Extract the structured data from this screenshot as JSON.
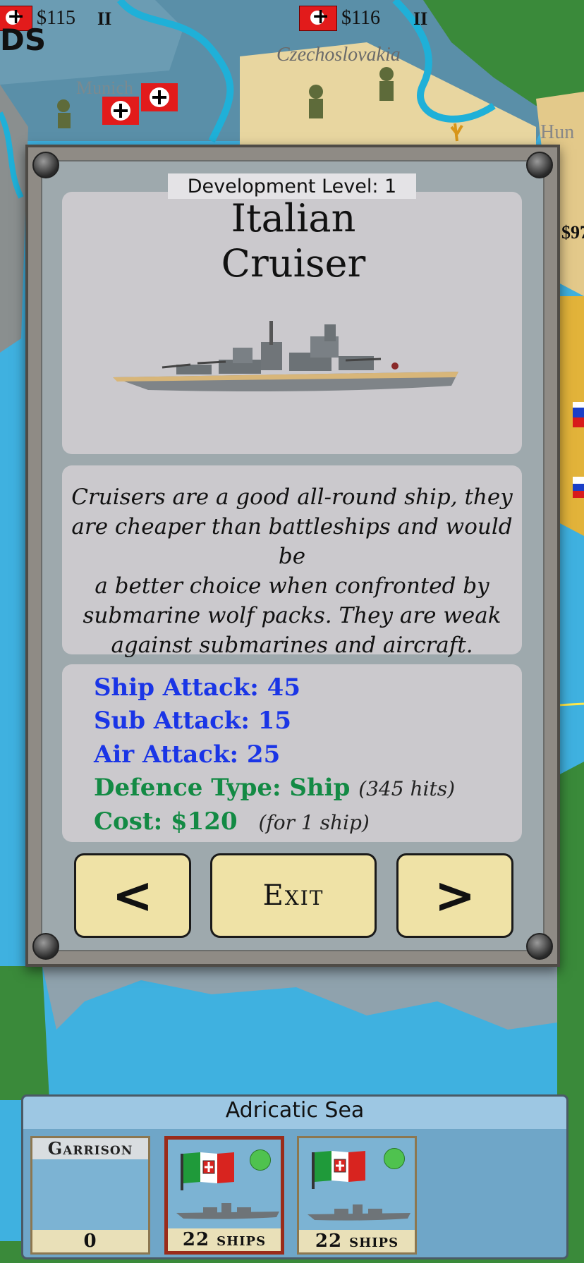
{
  "map": {
    "prices": [
      {
        "label": "$115",
        "roman": "II"
      },
      {
        "label": "$116",
        "roman": "II"
      },
      {
        "label": "$97"
      }
    ],
    "region_labels": [
      "DS",
      "Czechoslovakia",
      "Munich",
      "Hun"
    ],
    "colors": {
      "sea": "#3fb1e0",
      "land_green": "#3a8a3a",
      "land_tan": "#e8d6a0"
    }
  },
  "dialog": {
    "development_level": "Development Level: 1",
    "title_line1": "Italian",
    "title_line2": "Cruiser",
    "description_lines": [
      "Cruisers are a good all-round ship, they",
      "are cheaper than battleships and would be",
      "a better choice when confronted by",
      "submarine wolf packs. They are weak",
      "against submarines and aircraft."
    ],
    "stats": {
      "ship_attack": "Ship Attack: 45",
      "sub_attack": "Sub Attack: 15",
      "air_attack": "Air Attack: 25",
      "defence_type": "Defence Type: Ship",
      "defence_hits": "(345 hits)",
      "cost": "Cost: $120",
      "cost_note": "(for 1 ship)"
    },
    "buttons": {
      "prev": "<",
      "exit": "Exit",
      "next": ">"
    },
    "colors": {
      "stat_blue": "#1a35e6",
      "stat_green": "#138a44",
      "button_bg": "#efe2a6"
    }
  },
  "region": {
    "name": "Adricatic Sea",
    "cards": [
      {
        "title": "Garrison",
        "label": "0"
      },
      {
        "label": "22 ships",
        "selected": true
      },
      {
        "label": "22 ships",
        "selected": false
      }
    ]
  }
}
